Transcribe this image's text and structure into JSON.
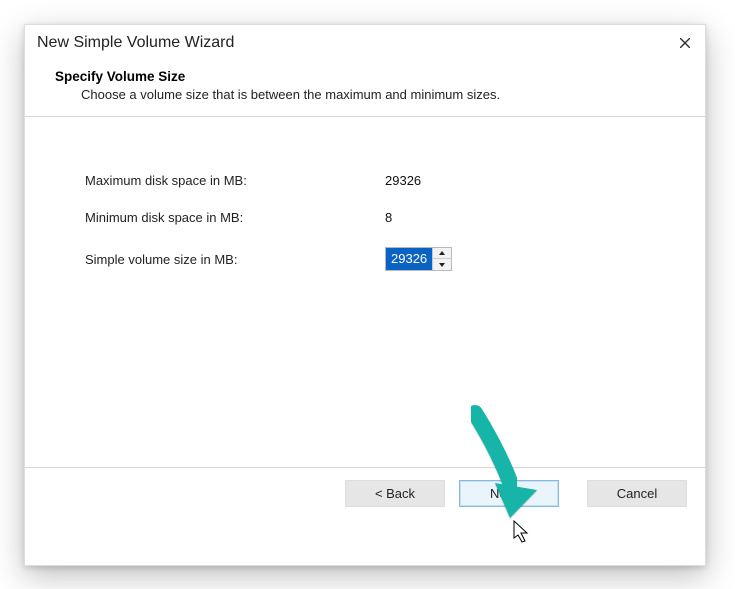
{
  "window": {
    "title": "New Simple Volume Wizard"
  },
  "header": {
    "title": "Specify Volume Size",
    "subtitle": "Choose a volume size that is between the maximum and minimum sizes."
  },
  "fields": {
    "max_label": "Maximum disk space in MB:",
    "max_value": "29326",
    "min_label": "Minimum disk space in MB:",
    "min_value": "8",
    "size_label": "Simple volume size in MB:",
    "size_value": "29326"
  },
  "buttons": {
    "back": "< Back",
    "next": "Next >",
    "cancel": "Cancel"
  }
}
